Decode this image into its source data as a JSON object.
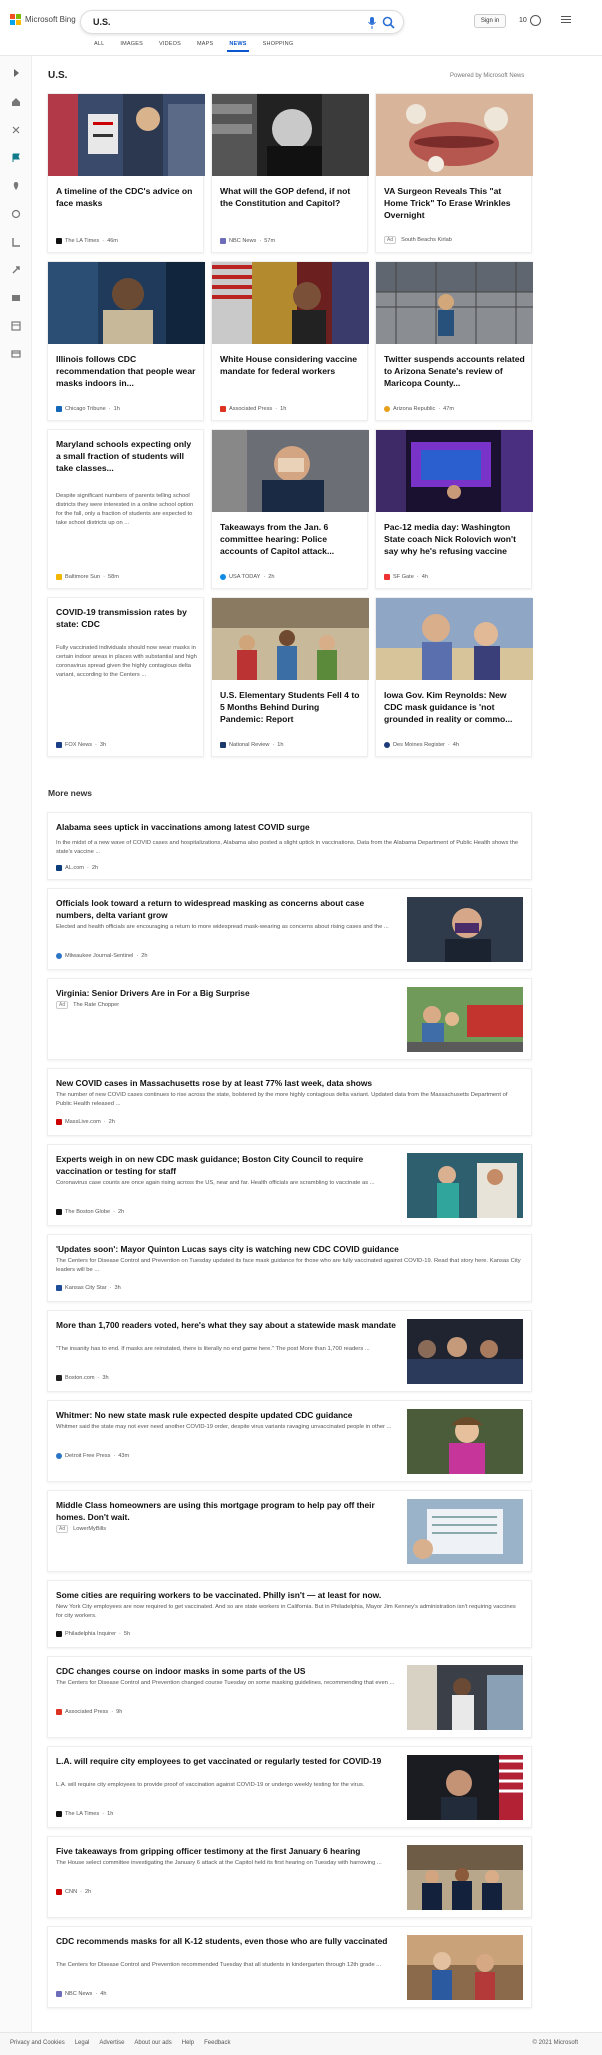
{
  "header": {
    "logo_text": "Microsoft Bing",
    "search_query": "U.S.",
    "signin_label": "Sign in",
    "rewards_count": "10",
    "tabs": [
      "ALL",
      "IMAGES",
      "VIDEOS",
      "MAPS",
      "NEWS",
      "SHOPPING"
    ],
    "active_tab": "NEWS"
  },
  "section": {
    "title": "U.S.",
    "powered_by": "Powered by Microsoft News"
  },
  "cards": [
    {
      "title": "A timeline of the CDC's advice on face masks",
      "source": "The LA Times",
      "time": "46m",
      "snippet": ""
    },
    {
      "title": "What will the GOP defend, if not the Constitution and Capitol?",
      "source": "NBC News",
      "time": "57m",
      "snippet": ""
    },
    {
      "title": "VA Surgeon Reveals This \"at Home Trick\" To Erase Wrinkles Overnight",
      "source": "South Beachs Kirlab",
      "time": "",
      "snippet": "",
      "ad": "Ad"
    },
    {
      "title": "Illinois follows CDC recommendation that people wear masks indoors in...",
      "source": "Chicago Tribune",
      "time": "1h",
      "snippet": ""
    },
    {
      "title": "White House considering vaccine mandate for federal workers",
      "source": "Associated Press",
      "time": "1h",
      "snippet": ""
    },
    {
      "title": "Twitter suspends accounts related to Arizona Senate's review of Maricopa County...",
      "source": "Arizona Republic",
      "time": "47m",
      "snippet": ""
    },
    {
      "title": "Maryland schools expecting only a small fraction of students will take classes...",
      "source": "Baltimore Sun",
      "time": "58m",
      "snippet": "Despite significant numbers of parents telling school districts they were interested in a online school option for the fall, only a fraction of students are expected to take school districts up on ..."
    },
    {
      "title": "Takeaways from the Jan. 6 committee hearing: Police accounts of Capitol attack...",
      "source": "USA TODAY",
      "time": "2h",
      "snippet": ""
    },
    {
      "title": "Pac-12 media day: Washington State coach Nick Rolovich won't say why he's refusing vaccine",
      "source": "SF Gate",
      "time": "4h",
      "snippet": ""
    },
    {
      "title": "COVID-19 transmission rates by state: CDC",
      "source": "FOX News",
      "time": "3h",
      "snippet": "Fully vaccinated individuals should now wear masks in certain indoor areas in places with substantial and high coronavirus spread given the highly contagious delta variant, according to the Centers ..."
    },
    {
      "title": "U.S. Elementary Students Fell 4 to 5 Months Behind During Pandemic: Report",
      "source": "National Review",
      "time": "1h",
      "snippet": ""
    },
    {
      "title": "Iowa Gov. Kim Reynolds: New CDC mask guidance is 'not grounded in reality or commo...",
      "source": "Des Moines Register",
      "time": "4h",
      "snippet": ""
    }
  ],
  "more_news_title": "More news",
  "more_news": [
    {
      "title": "Alabama sees uptick in vaccinations among latest COVID surge",
      "snippet": "In the midst of a new wave of COVID cases and hospitalizations, Alabama also posted a slight uptick in vaccinations. Data from the Alabama Department of Public Health shows the state's vaccine ...",
      "source": "AL.com",
      "time": "2h"
    },
    {
      "title": "Officials look toward a return to widespread masking as concerns about case numbers, delta variant grow",
      "snippet": "Elected and health officials are encouraging a return to more widespread mask-wearing as concerns about rising cases and the ...",
      "source": "Milwaukee Journal-Sentinel",
      "time": "2h"
    },
    {
      "title": "Virginia: Senior Drivers Are in For a Big Surprise",
      "snippet": "",
      "source": "The Rate Chopper",
      "time": "",
      "ad": "Ad"
    },
    {
      "title": "New COVID cases in Massachusetts rose by at least 77% last week, data shows",
      "snippet": "The number of new COVID cases continues to rise across the state, bolstered by the more highly contagious delta variant. Updated data from the Massachusetts Department of Public Health released ...",
      "source": "MassLive.com",
      "time": "2h"
    },
    {
      "title": "Experts weigh in on new CDC mask guidance; Boston City Council to require vaccination or testing for staff",
      "snippet": "Coronavirus case counts are once again rising across the US, near and far. Health officials are scrambling to vaccinate as ...",
      "source": "The Boston Globe",
      "time": "2h"
    },
    {
      "title": "'Updates soon': Mayor Quinton Lucas says city is watching new CDC COVID guidance",
      "snippet": "The Centers for Disease Control and Prevention on Tuesday updated its face mask guidance for those who are fully vaccinated against COVID-19. Read that story here. Kansas City leaders will be ...",
      "source": "Kansas City Star",
      "time": "3h"
    },
    {
      "title": "More than 1,700 readers voted, here's what they say about a statewide mask mandate",
      "snippet": "\"The insanity has to end. If masks are reinstated, there is literally no end game here.\" The post More than 1,700 readers ...",
      "source": "Boston.com",
      "time": "3h"
    },
    {
      "title": "Whitmer: No new state mask rule expected despite updated CDC guidance",
      "snippet": "Whitmer said the state may not ever need another COVID-19 order, despite virus variants ravaging unvaccinated people in other ...",
      "source": "Detroit Free Press",
      "time": "43m"
    },
    {
      "title": "Middle Class homeowners are using this mortgage program to help pay off their homes. Don't wait.",
      "snippet": "",
      "source": "LowerMyBills",
      "time": "",
      "ad": "Ad"
    },
    {
      "title": "Some cities are requiring workers to be vaccinated. Philly isn't — at least for now.",
      "snippet": "New York City employees are now required to get vaccinated. And so are state workers in California. But in Philadelphia, Mayor Jim Kenney's administration isn't requiring vaccines for city workers.",
      "source": "Philadelphia Inquirer",
      "time": "5h"
    },
    {
      "title": "CDC changes course on indoor masks in some parts of the US",
      "snippet": "The Centers for Disease Control and Prevention changed course Tuesday on some masking guidelines, recommending that even ...",
      "source": "Associated Press",
      "time": "9h"
    },
    {
      "title": "L.A. will require city employees to get vaccinated or regularly tested for COVID-19",
      "snippet": "L.A. will require city employees to provide proof of vaccination against COVID-19 or undergo weekly testing for the virus.",
      "source": "The LA Times",
      "time": "1h"
    },
    {
      "title": "Five takeaways from gripping officer testimony at the first January 6 hearing",
      "snippet": "The House select committee investigating the January 6 attack at the Capitol held its first hearing on Tuesday with harrowing ...",
      "source": "CNN",
      "time": "2h"
    },
    {
      "title": "CDC recommends masks for all K-12 students, even those who are fully vaccinated",
      "snippet": "The Centers for Disease Control and Prevention recommended Tuesday that all students in kindergarten through 12th grade ...",
      "source": "NBC News",
      "time": "4h"
    }
  ],
  "footer": {
    "links": [
      "Privacy and Cookies",
      "Legal",
      "Advertise",
      "About our ads",
      "Help",
      "Feedback"
    ],
    "copyright": "© 2021 Microsoft"
  },
  "colors": {
    "accent": "#0b57d0",
    "rail_active": "#117a8b"
  }
}
